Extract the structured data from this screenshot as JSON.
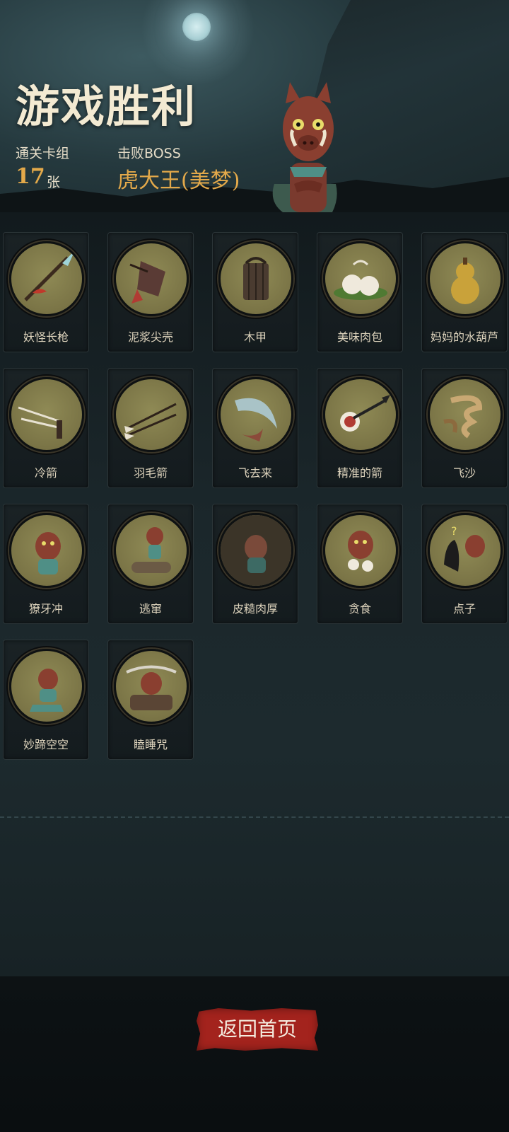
{
  "header": {
    "title": "游戏胜利",
    "cleared_deck_label": "通关卡组",
    "cleared_deck_count": "17",
    "cleared_deck_unit": "张",
    "boss_label": "击败BOSS",
    "boss_name": "虎大王(美梦)"
  },
  "cards": [
    {
      "name": "妖怪长枪",
      "icon": "spear-icon"
    },
    {
      "name": "泥浆尖壳",
      "icon": "gauntlet-icon"
    },
    {
      "name": "木甲",
      "icon": "wooden-armor-icon"
    },
    {
      "name": "美味肉包",
      "icon": "buns-icon"
    },
    {
      "name": "妈妈的水葫芦",
      "icon": "gourd-icon"
    },
    {
      "name": "冷箭",
      "icon": "cold-arrow-icon"
    },
    {
      "name": "羽毛箭",
      "icon": "feather-arrow-icon"
    },
    {
      "name": "飞去来",
      "icon": "boomerang-icon"
    },
    {
      "name": "精准的箭",
      "icon": "target-arrow-icon"
    },
    {
      "name": "飞沙",
      "icon": "sand-whirl-icon"
    },
    {
      "name": "獠牙冲",
      "icon": "boar-charge-icon"
    },
    {
      "name": "逃窜",
      "icon": "boar-flee-icon"
    },
    {
      "name": "皮糙肉厚",
      "icon": "boar-tough-icon"
    },
    {
      "name": "贪食",
      "icon": "boar-eat-icon"
    },
    {
      "name": "点子",
      "icon": "boar-idea-icon"
    },
    {
      "name": "妙蹄空空",
      "icon": "boar-kick-icon"
    },
    {
      "name": "瞌睡咒",
      "icon": "boar-sleep-icon"
    }
  ],
  "footer": {
    "return_label": "返回首页"
  },
  "colors": {
    "accent": "#e3a94a",
    "button": "#a3231d",
    "disc": "#8f8a55"
  }
}
